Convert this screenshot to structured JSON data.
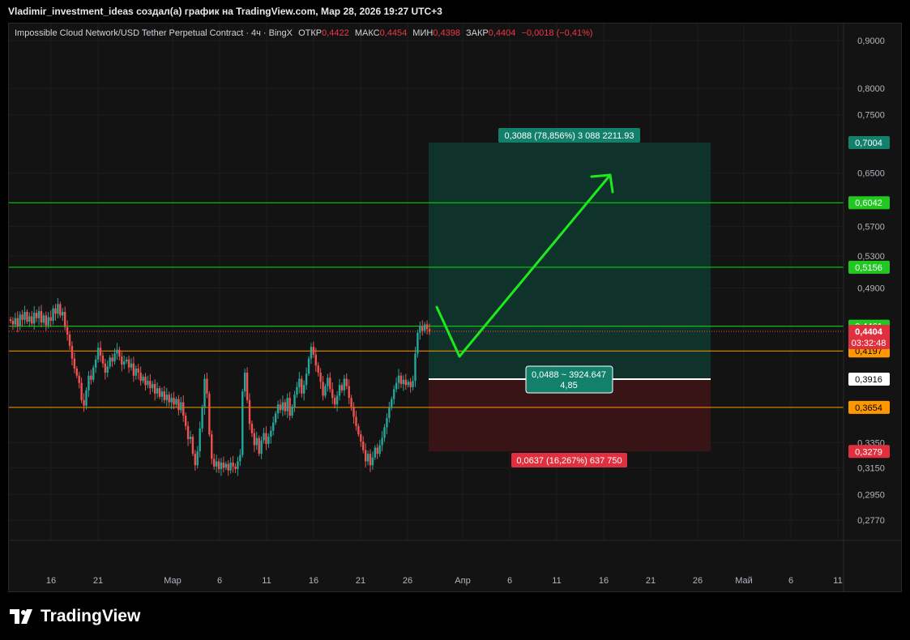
{
  "header": {
    "attribution": "Vladimir_investment_ideas создал(а) график на TradingView.com, Мар 28, 2026 19:27 UTC+3"
  },
  "legend": {
    "symbol": "Impossible Cloud Network/USD Tether Perpetual Contract · 4ч · BingX",
    "open_label": "ОТКР",
    "open_value": "0,4422",
    "high_label": "МАКС",
    "high_value": "0,4454",
    "low_label": "МИН",
    "low_value": "0,4398",
    "close_label": "ЗАКР",
    "close_value": "0,4404",
    "change": "−0,0018 (−0,41%)"
  },
  "footer": {
    "brand": "TradingView"
  },
  "colors": {
    "up": "#26a69a",
    "down": "#ef5350",
    "green_level": "#00e500",
    "orange_level": "#ff9800",
    "profit_zone": "#0f3a30",
    "loss_zone": "#3d1518",
    "arrow": "#1ee81e",
    "entry_line": "#ffffff"
  },
  "chart_data": {
    "type": "candlestick",
    "interval": "4h",
    "y_axis": {
      "scale": "log",
      "ylim": [
        0.262,
        0.92
      ],
      "ticks": [
        "0,9000",
        "0,8000",
        "0,7500",
        "0,6500",
        "0,5700",
        "0,5300",
        "0,4900",
        "0,3350",
        "0,3150",
        "0,2950",
        "0,2770"
      ]
    },
    "x_axis": {
      "ticks": [
        "16",
        "21",
        "Мар",
        "6",
        "11",
        "16",
        "21",
        "26",
        "Апр",
        "6",
        "11",
        "16",
        "21",
        "26",
        "Май",
        "6",
        "11"
      ]
    },
    "horizontal_levels": [
      {
        "value": 0.6042,
        "label": "0,6042",
        "color": "green"
      },
      {
        "value": 0.5156,
        "label": "0,5156",
        "color": "green"
      },
      {
        "value": 0.4461,
        "label": "0,4461",
        "color": "green"
      },
      {
        "value": 0.4197,
        "label": "0,4197",
        "color": "orange"
      },
      {
        "value": 0.3654,
        "label": "0,3654",
        "color": "orange"
      }
    ],
    "last_price": {
      "value": 0.4404,
      "label": "0,4404",
      "countdown": "03:32:48"
    },
    "position": {
      "type": "long",
      "entry": 0.3916,
      "entry_label": "0,3916",
      "target": 0.7004,
      "target_label": "0,7004",
      "stop": 0.3279,
      "stop_label": "0,3279",
      "profit_text": "0,3088 (78,856%) 3 088 2211.93",
      "stop_text": "0,0637 (16,267%) 637 750",
      "ratio_line1": "0,0488 ~ 3924.647",
      "ratio_line2": "4,85"
    },
    "projection_arrow": {
      "points": [
        [
          0.4,
          0.46
        ],
        [
          0.42,
          0.415
        ],
        [
          0.48,
          0.645
        ]
      ],
      "note": "x in fraction of session, y in price"
    },
    "candles_close": [
      0.452,
      0.448,
      0.455,
      0.446,
      0.459,
      0.453,
      0.462,
      0.451,
      0.457,
      0.449,
      0.461,
      0.455,
      0.463,
      0.45,
      0.458,
      0.447,
      0.456,
      0.452,
      0.466,
      0.46,
      0.471,
      0.458,
      0.462,
      0.445,
      0.437,
      0.425,
      0.412,
      0.402,
      0.395,
      0.388,
      0.372,
      0.367,
      0.381,
      0.395,
      0.391,
      0.403,
      0.411,
      0.423,
      0.415,
      0.407,
      0.398,
      0.404,
      0.413,
      0.409,
      0.417,
      0.421,
      0.414,
      0.406,
      0.409,
      0.411,
      0.403,
      0.407,
      0.395,
      0.402,
      0.398,
      0.39,
      0.394,
      0.386,
      0.39,
      0.383,
      0.387,
      0.378,
      0.383,
      0.375,
      0.38,
      0.372,
      0.377,
      0.37,
      0.374,
      0.368,
      0.373,
      0.363,
      0.37,
      0.358,
      0.349,
      0.338,
      0.34,
      0.326,
      0.317,
      0.328,
      0.347,
      0.365,
      0.392,
      0.378,
      0.342,
      0.322,
      0.316,
      0.32,
      0.314,
      0.319,
      0.315,
      0.318,
      0.313,
      0.319,
      0.316,
      0.314,
      0.32,
      0.325,
      0.38,
      0.398,
      0.372,
      0.351,
      0.343,
      0.333,
      0.339,
      0.326,
      0.337,
      0.343,
      0.334,
      0.34,
      0.345,
      0.352,
      0.36,
      0.368,
      0.363,
      0.37,
      0.362,
      0.374,
      0.358,
      0.366,
      0.377,
      0.384,
      0.392,
      0.378,
      0.386,
      0.397,
      0.412,
      0.424,
      0.416,
      0.405,
      0.398,
      0.389,
      0.376,
      0.385,
      0.393,
      0.382,
      0.374,
      0.368,
      0.376,
      0.386,
      0.381,
      0.392,
      0.385,
      0.374,
      0.366,
      0.357,
      0.349,
      0.342,
      0.336,
      0.329,
      0.32,
      0.326,
      0.317,
      0.323,
      0.331,
      0.326,
      0.333,
      0.339,
      0.348,
      0.356,
      0.365,
      0.373,
      0.382,
      0.388,
      0.395,
      0.387,
      0.391,
      0.386,
      0.389,
      0.384,
      0.39,
      0.417,
      0.439,
      0.446,
      0.441,
      0.448,
      0.443,
      0.44
    ]
  }
}
